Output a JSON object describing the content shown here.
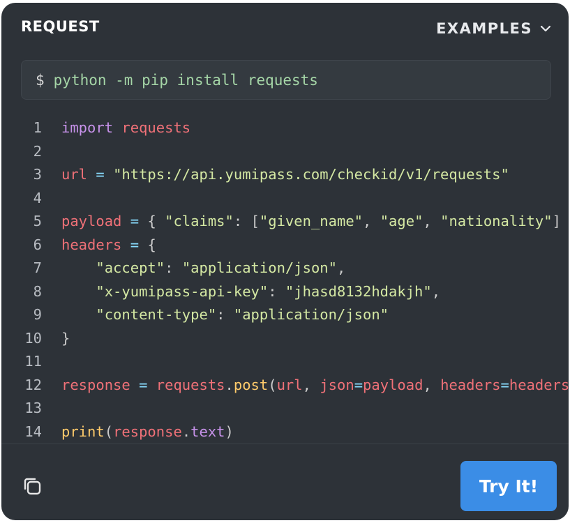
{
  "header": {
    "title": "REQUEST",
    "examples_label": "EXAMPLES"
  },
  "install": {
    "prompt": "$",
    "command": "python -m pip install requests"
  },
  "code": {
    "line_numbers": [
      "1",
      "2",
      "3",
      "4",
      "5",
      "6",
      "7",
      "8",
      "9",
      "10",
      "11",
      "12",
      "13",
      "14"
    ],
    "lines": [
      "import requests",
      "",
      "url = \"https://api.yumipass.com/checkid/v1/requests\"",
      "",
      "payload = { \"claims\": [\"given_name\", \"age\", \"nationality\"] }",
      "headers = {",
      "    \"accept\": \"application/json\",",
      "    \"x-yumipass-api-key\": \"jhasd8132hdakjh\",",
      "    \"content-type\": \"application/json\"",
      "}",
      "",
      "response = requests.post(url, json=payload, headers=headers)",
      "",
      "print(response.text)"
    ]
  },
  "footer": {
    "copy_icon": "copy-icon",
    "try_label": "Try It!"
  },
  "colors": {
    "panel": "#2d3238",
    "button": "#3b8de6",
    "keyword": "#c792ea",
    "variable": "#f07178",
    "string": "#d4e8a3",
    "operator": "#89ddff"
  }
}
